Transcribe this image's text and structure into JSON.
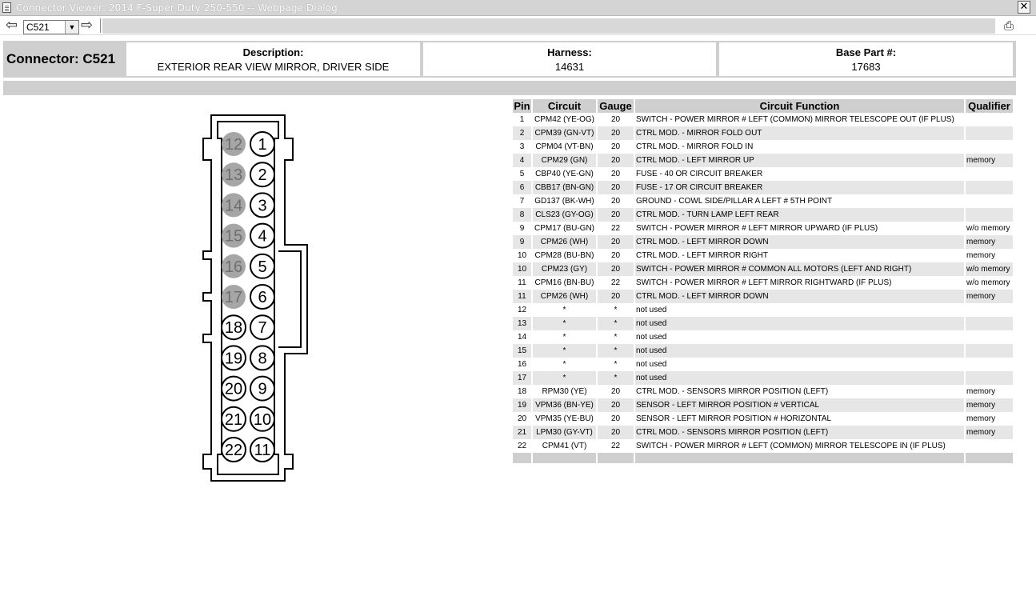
{
  "window": {
    "title": "Connector Viewer: 2014 F-Super Duty 250-550 -- Webpage Dialog",
    "close_glyph": "✕"
  },
  "toolbar": {
    "selected_connector": "C521",
    "back_glyph": "⇦",
    "forward_glyph": "⇨",
    "print_glyph": "⎙"
  },
  "header": {
    "connector_label": "Connector: C521",
    "description_label": "Description:",
    "description_value": "EXTERIOR REAR VIEW MIRROR, DRIVER SIDE",
    "harness_label": "Harness:",
    "harness_value": "14631",
    "base_part_label": "Base Part #:",
    "base_part_value": "17683"
  },
  "table": {
    "columns": [
      "Pin",
      "Circuit",
      "Gauge",
      "Circuit Function",
      "Qualifier"
    ],
    "rows": [
      {
        "pin": "1",
        "circuit": "CPM42 (YE-OG)",
        "gauge": "20",
        "function": "SWITCH - POWER MIRROR # LEFT (COMMON) MIRROR TELESCOPE OUT (IF PLUS)",
        "qualifier": ""
      },
      {
        "pin": "2",
        "circuit": "CPM39 (GN-VT)",
        "gauge": "20",
        "function": "CTRL MOD. - MIRROR FOLD OUT",
        "qualifier": ""
      },
      {
        "pin": "3",
        "circuit": "CPM04 (VT-BN)",
        "gauge": "20",
        "function": "CTRL MOD. - MIRROR FOLD IN",
        "qualifier": ""
      },
      {
        "pin": "4",
        "circuit": "CPM29 (GN)",
        "gauge": "20",
        "function": "CTRL MOD. - LEFT MIRROR UP",
        "qualifier": "memory"
      },
      {
        "pin": "5",
        "circuit": "CBP40 (YE-GN)",
        "gauge": "20",
        "function": "FUSE - 40 OR CIRCUIT BREAKER",
        "qualifier": ""
      },
      {
        "pin": "6",
        "circuit": "CBB17 (BN-GN)",
        "gauge": "20",
        "function": "FUSE - 17 OR CIRCUIT BREAKER",
        "qualifier": ""
      },
      {
        "pin": "7",
        "circuit": "GD137 (BK-WH)",
        "gauge": "20",
        "function": "GROUND - COWL SIDE/PILLAR A LEFT # 5TH POINT",
        "qualifier": ""
      },
      {
        "pin": "8",
        "circuit": "CLS23 (GY-OG)",
        "gauge": "20",
        "function": "CTRL MOD. - TURN LAMP LEFT REAR",
        "qualifier": ""
      },
      {
        "pin": "9",
        "circuit": "CPM17 (BU-GN)",
        "gauge": "22",
        "function": "SWITCH - POWER MIRROR # LEFT MIRROR UPWARD (IF PLUS)",
        "qualifier": "w/o memory"
      },
      {
        "pin": "9",
        "circuit": "CPM26 (WH)",
        "gauge": "20",
        "function": "CTRL MOD. - LEFT MIRROR DOWN",
        "qualifier": "memory"
      },
      {
        "pin": "10",
        "circuit": "CPM28 (BU-BN)",
        "gauge": "20",
        "function": "CTRL MOD. - LEFT MIRROR RIGHT",
        "qualifier": "memory"
      },
      {
        "pin": "10",
        "circuit": "CPM23 (GY)",
        "gauge": "20",
        "function": "SWITCH - POWER MIRROR # COMMON ALL MOTORS (LEFT AND RIGHT)",
        "qualifier": "w/o memory"
      },
      {
        "pin": "11",
        "circuit": "CPM16 (BN-BU)",
        "gauge": "22",
        "function": "SWITCH - POWER MIRROR # LEFT MIRROR RIGHTWARD (IF PLUS)",
        "qualifier": "w/o memory"
      },
      {
        "pin": "11",
        "circuit": "CPM26 (WH)",
        "gauge": "20",
        "function": "CTRL MOD. - LEFT MIRROR DOWN",
        "qualifier": "memory"
      },
      {
        "pin": "12",
        "circuit": "*",
        "gauge": "*",
        "function": "not used",
        "qualifier": ""
      },
      {
        "pin": "13",
        "circuit": "*",
        "gauge": "*",
        "function": "not used",
        "qualifier": ""
      },
      {
        "pin": "14",
        "circuit": "*",
        "gauge": "*",
        "function": "not used",
        "qualifier": ""
      },
      {
        "pin": "15",
        "circuit": "*",
        "gauge": "*",
        "function": "not used",
        "qualifier": ""
      },
      {
        "pin": "16",
        "circuit": "*",
        "gauge": "*",
        "function": "not used",
        "qualifier": ""
      },
      {
        "pin": "17",
        "circuit": "*",
        "gauge": "*",
        "function": "not used",
        "qualifier": ""
      },
      {
        "pin": "18",
        "circuit": "RPM30 (YE)",
        "gauge": "20",
        "function": "CTRL MOD. - SENSORS MIRROR POSITION (LEFT)",
        "qualifier": "memory"
      },
      {
        "pin": "19",
        "circuit": "VPM36 (BN-YE)",
        "gauge": "20",
        "function": "SENSOR - LEFT MIRROR POSITION # VERTICAL",
        "qualifier": "memory"
      },
      {
        "pin": "20",
        "circuit": "VPM35 (YE-BU)",
        "gauge": "20",
        "function": "SENSOR - LEFT MIRROR POSITION # HORIZONTAL",
        "qualifier": "memory"
      },
      {
        "pin": "21",
        "circuit": "LPM30 (GY-VT)",
        "gauge": "20",
        "function": "CTRL MOD. - SENSORS MIRROR POSITION (LEFT)",
        "qualifier": "memory"
      },
      {
        "pin": "22",
        "circuit": "CPM41 (VT)",
        "gauge": "22",
        "function": "SWITCH - POWER MIRROR # LEFT (COMMON) MIRROR TELESCOPE IN (IF PLUS)",
        "qualifier": ""
      }
    ]
  },
  "diagram": {
    "right_column_pins": [
      "1",
      "2",
      "3",
      "4",
      "5",
      "6",
      "7",
      "8",
      "9",
      "10",
      "11"
    ],
    "left_column_pins": [
      "12",
      "13",
      "14",
      "15",
      "16",
      "17",
      "18",
      "19",
      "20",
      "21",
      "22"
    ],
    "unused_pins": [
      "12",
      "13",
      "14",
      "15",
      "16",
      "17"
    ],
    "unused_fill": "#a6a6a6"
  }
}
